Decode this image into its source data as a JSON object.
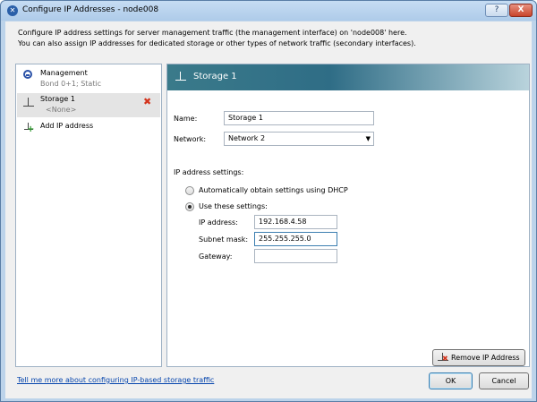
{
  "window": {
    "title": "Configure IP Addresses - node008",
    "help_button": "?",
    "close_button": "X"
  },
  "description": {
    "line1": "Configure IP address settings for server management traffic (the management interface) on 'node008' here.",
    "line2": "You can also assign IP addresses for dedicated storage or other types of network traffic (secondary interfaces)."
  },
  "sidebar": {
    "items": [
      {
        "name": "Management",
        "detail": "Bond 0+1; Static"
      },
      {
        "name": "Storage 1",
        "detail": "<None>"
      }
    ],
    "add_label": "Add IP address"
  },
  "panel": {
    "title": "Storage 1",
    "name_label": "Name:",
    "name_value": "Storage 1",
    "network_label": "Network:",
    "network_value": "Network 2",
    "ip_section_label": "IP address settings:",
    "dhcp_label": "Automatically obtain settings using DHCP",
    "dhcp_selected": false,
    "static_label": "Use these settings:",
    "static_selected": true,
    "ip_label": "IP address:",
    "ip_value": "192.168.4.58",
    "mask_label": "Subnet mask:",
    "mask_value": "255.255.255.0",
    "gateway_label": "Gateway:",
    "gateway_value": "",
    "remove_button": "Remove IP Address"
  },
  "footer": {
    "help_link": "Tell me more about configuring IP-based storage traffic",
    "ok_button": "OK",
    "cancel_button": "Cancel"
  }
}
